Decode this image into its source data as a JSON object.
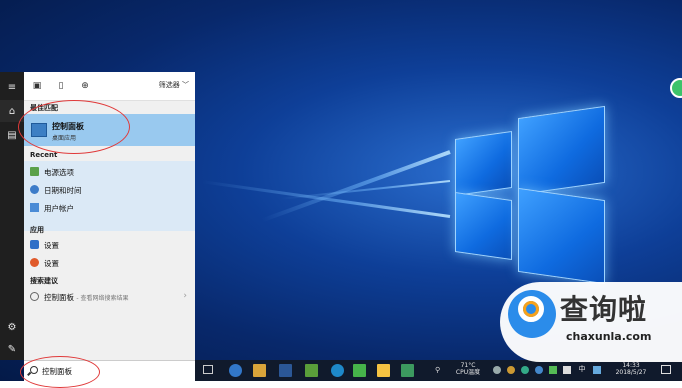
{
  "start_menu": {
    "filter_label": "筛选器",
    "best_match": {
      "header": "最佳匹配",
      "title": "控制面板",
      "subtitle": "桌面应用"
    },
    "recent": {
      "header": "Recent",
      "items": [
        {
          "label": "电源选项",
          "icon": "power-options-icon"
        },
        {
          "label": "日期和时间",
          "icon": "clock-icon"
        },
        {
          "label": "用户帐户",
          "icon": "user-accounts-icon"
        }
      ]
    },
    "apps": {
      "header": "应用",
      "items": [
        {
          "label": "设置",
          "icon": "settings-gear-icon"
        },
        {
          "label": "设置",
          "icon": "settings-app-icon"
        }
      ]
    },
    "suggestions": {
      "header": "搜索建议",
      "items": [
        {
          "label": "控制面板",
          "hint": "- 查看网络搜索结果"
        }
      ]
    }
  },
  "search": {
    "value": "控制面板"
  },
  "taskbar": {
    "temperature": "71°C",
    "cpu_label": "CPU温度",
    "ime": "中",
    "time": "14:33",
    "date": "2018/5/27"
  },
  "watermark": {
    "text_cn": "查询啦",
    "text_en": "chaxunla.com"
  },
  "colors": {
    "accent": "#99c9ef",
    "annotation": "#e03a3a",
    "rail": "#1f1f1f",
    "taskbar": "#101a2c"
  }
}
